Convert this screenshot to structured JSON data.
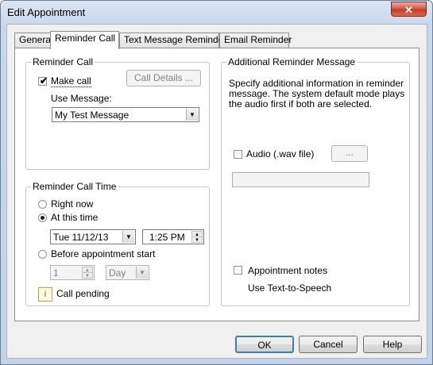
{
  "window": {
    "title": "Edit Appointment",
    "close_glyph": "✕"
  },
  "tabs": [
    {
      "label": "General"
    },
    {
      "label": "Reminder Call"
    },
    {
      "label": "Text Message Reminder"
    },
    {
      "label": "Email Reminder"
    }
  ],
  "reminder_call": {
    "group_label": "Reminder Call",
    "make_call_label": "Make call",
    "make_call_checked": true,
    "call_details_label": "Call Details ...",
    "use_message_label": "Use Message:",
    "message_value": "My Test Message"
  },
  "call_time": {
    "group_label": "Reminder Call Time",
    "right_now_label": "Right now",
    "at_this_time_label": "At this time",
    "selected": "at_this_time",
    "date_value": "Tue  11/12/13",
    "time_value": "1:25 PM",
    "before_start_label": "Before appointment start",
    "before_amount": "1",
    "before_unit": "Day",
    "call_pending_label": "Call pending"
  },
  "additional": {
    "group_label": "Additional Reminder Message",
    "description": [
      "Specify additional information in reminder",
      "message. The system default mode plays",
      "the audio first if both are selected."
    ],
    "audio_label": "Audio (.wav file)",
    "audio_browse_label": "...",
    "appointment_notes_label": "Appointment notes",
    "tts_label": "Use Text-to-Speech"
  },
  "footer": {
    "ok_label": "OK",
    "cancel_label": "Cancel",
    "help_label": "Help"
  },
  "icons": {
    "checkmark": "✔",
    "dropdown": "▼",
    "spin_up": "▲",
    "spin_down": "▼",
    "pending": "i"
  }
}
